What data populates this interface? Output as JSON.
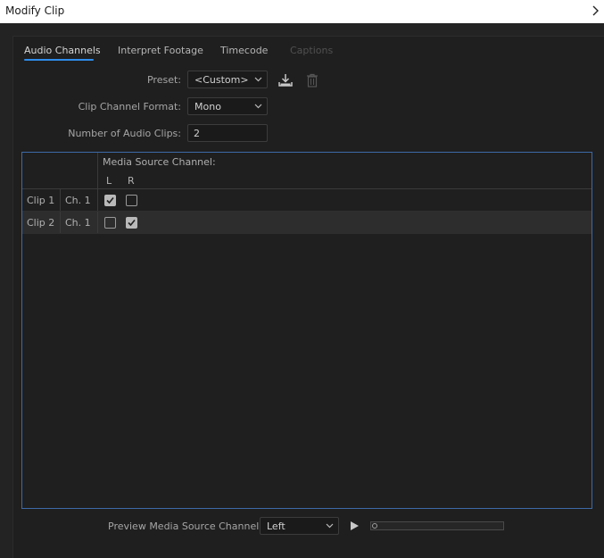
{
  "window": {
    "title": "Modify Clip"
  },
  "tabs": [
    {
      "label": "Audio Channels",
      "state": "active"
    },
    {
      "label": "Interpret Footage",
      "state": "normal"
    },
    {
      "label": "Timecode",
      "state": "normal"
    },
    {
      "label": "Captions",
      "state": "disabled"
    }
  ],
  "form": {
    "preset_label": "Preset:",
    "preset_value": "<Custom>",
    "format_label": "Clip Channel Format:",
    "format_value": "Mono",
    "num_clips_label": "Number of Audio Clips:",
    "num_clips_value": "2"
  },
  "icons": {
    "save_preset": "save-preset-icon",
    "delete_preset": "trash-icon",
    "play": "play-icon",
    "chevron": "chevron-right-icon"
  },
  "table": {
    "header": "Media Source Channel:",
    "columns": [
      "L",
      "R"
    ],
    "rows": [
      {
        "clip": "Clip 1",
        "channel": "Ch. 1",
        "L": true,
        "R": false
      },
      {
        "clip": "Clip 2",
        "channel": "Ch. 1",
        "L": false,
        "R": true
      }
    ]
  },
  "preview": {
    "label": "Preview Media Source Channel:",
    "channel_value": "Left",
    "progress": 0
  },
  "colors": {
    "accent": "#2d8ceb",
    "table_border": "#3d6aa8",
    "background": "#1f1f1f"
  }
}
